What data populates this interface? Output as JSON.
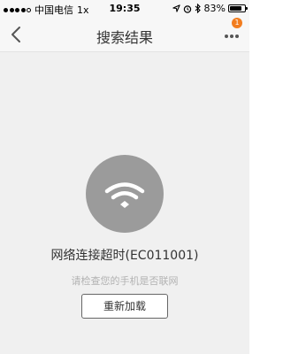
{
  "status_bar": {
    "carrier": "中国电信",
    "network": "1x",
    "time": "19:35",
    "battery_percent": "83%",
    "battery_level": 0.83,
    "signal_bars_filled": 4,
    "signal_bars_total": 5,
    "icons": [
      "location-arrow-icon",
      "alarm-icon",
      "bluetooth-icon"
    ]
  },
  "nav": {
    "title": "搜索结果",
    "badge_count": "1",
    "icons": {
      "back": "chevron-left-icon",
      "more": "more-dots-icon"
    }
  },
  "error": {
    "title": "网络连接超时(EC011001)",
    "subtitle": "请检查您的手机是否联网",
    "reload_label": "重新加载"
  },
  "colors": {
    "accent": "#f27d1f",
    "wifi_circle": "#9b9b9b",
    "background": "#f0f0f0"
  }
}
